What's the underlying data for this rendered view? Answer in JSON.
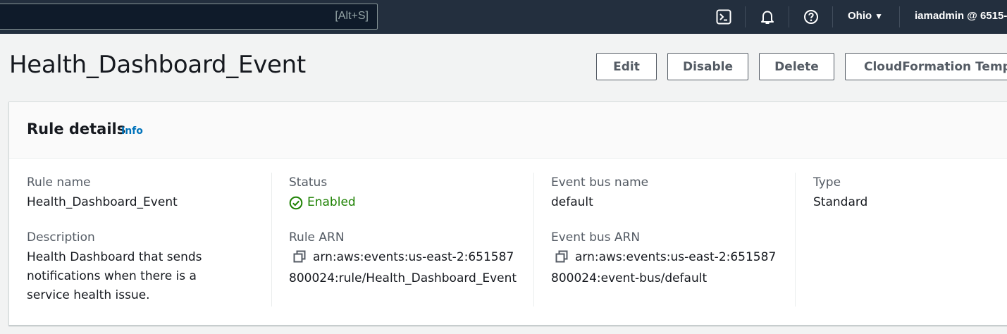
{
  "topnav": {
    "search_shortcut": "[Alt+S]",
    "icons": [
      "cloudshell-icon",
      "bell-icon",
      "help-icon"
    ],
    "region": "Ohio",
    "account": "iamadmin @ 6515-"
  },
  "header": {
    "title": "Health_Dashboard_Event",
    "buttons": {
      "edit": "Edit",
      "disable": "Disable",
      "delete": "Delete",
      "cloudformation": "CloudFormation Template"
    }
  },
  "rule_details": {
    "title": "Rule details",
    "info": "Info",
    "rule_name_label": "Rule name",
    "rule_name_value": "Health_Dashboard_Event",
    "description_label": "Description",
    "description_value": "Health Dashboard that sends notifications when there is a service health issue.",
    "status_label": "Status",
    "status_value": "Enabled",
    "rule_arn_label": "Rule ARN",
    "rule_arn_value": "arn:aws:events:us-east-2:651587800024:rule/Health_Dashboard_Event",
    "event_bus_name_label": "Event bus name",
    "event_bus_name_value": "default",
    "event_bus_arn_label": "Event bus ARN",
    "event_bus_arn_value": "arn:aws:events:us-east-2:651587800024:event-bus/default",
    "type_label": "Type",
    "type_value": "Standard"
  },
  "colors": {
    "nav_bg": "#232f3e",
    "status_green": "#1d8102",
    "link_blue": "#0073bb"
  }
}
